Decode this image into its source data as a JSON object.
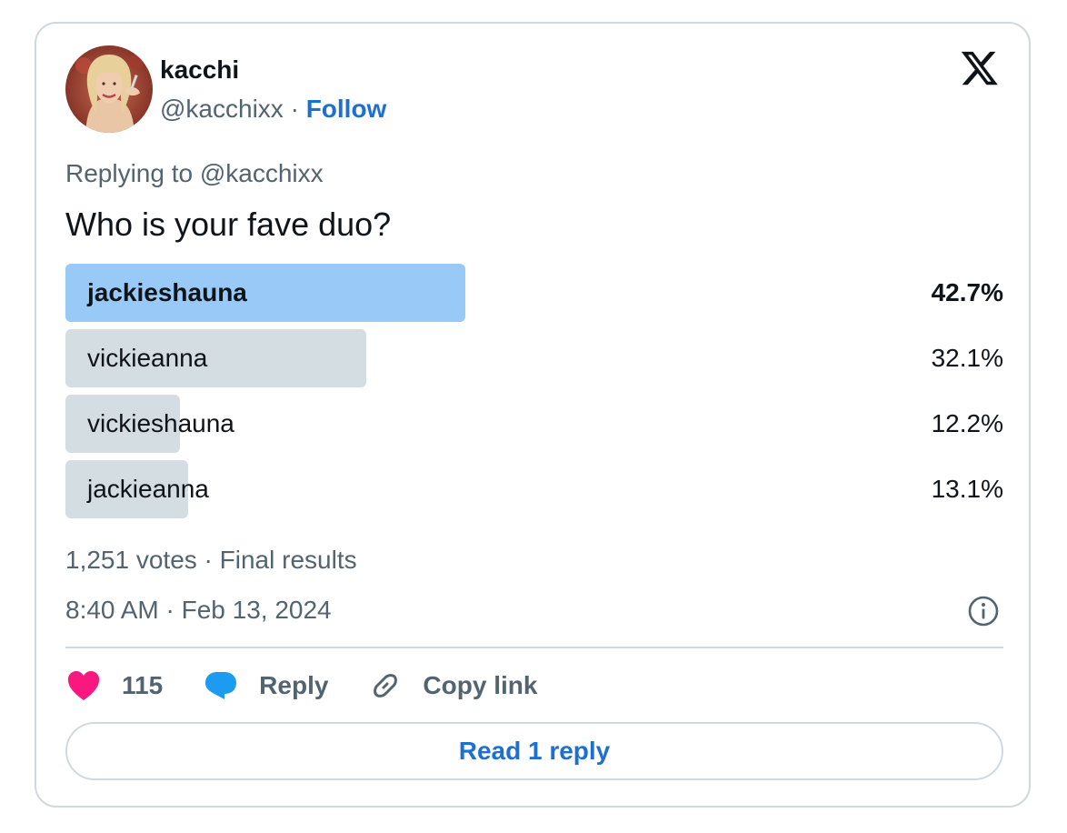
{
  "author": {
    "display_name": "kacchi",
    "handle": "@kacchixx",
    "separator": "·",
    "follow_label": "Follow",
    "avatar_icon": "profile-photo"
  },
  "brand_icon": "x-logo-icon",
  "replying_to": "Replying to @kacchixx",
  "tweet_text": "Who is your fave duo?",
  "poll": {
    "options": [
      {
        "label": "jackieshauna",
        "percent_text": "42.7%",
        "percent": 42.7,
        "winner": true
      },
      {
        "label": "vickieanna",
        "percent_text": "32.1%",
        "percent": 32.1,
        "winner": false
      },
      {
        "label": "vickieshauna",
        "percent_text": "12.2%",
        "percent": 12.2,
        "winner": false
      },
      {
        "label": "jackieanna",
        "percent_text": "13.1%",
        "percent": 13.1,
        "winner": false
      }
    ],
    "summary": "1,251 votes · Final results"
  },
  "timestamp": "8:40 AM · Feb 13, 2024",
  "actions": {
    "likes_count": "115",
    "reply_label": "Reply",
    "copy_link_label": "Copy link"
  },
  "read_replies_label": "Read 1 reply",
  "colors": {
    "accent": "#1d6fd1",
    "winner_bar": "#8ec3f5",
    "other_bar": "#cfd9de",
    "heart": "#f91880",
    "reply_bubble": "#1d9bf0",
    "secondary_text": "#536471"
  }
}
